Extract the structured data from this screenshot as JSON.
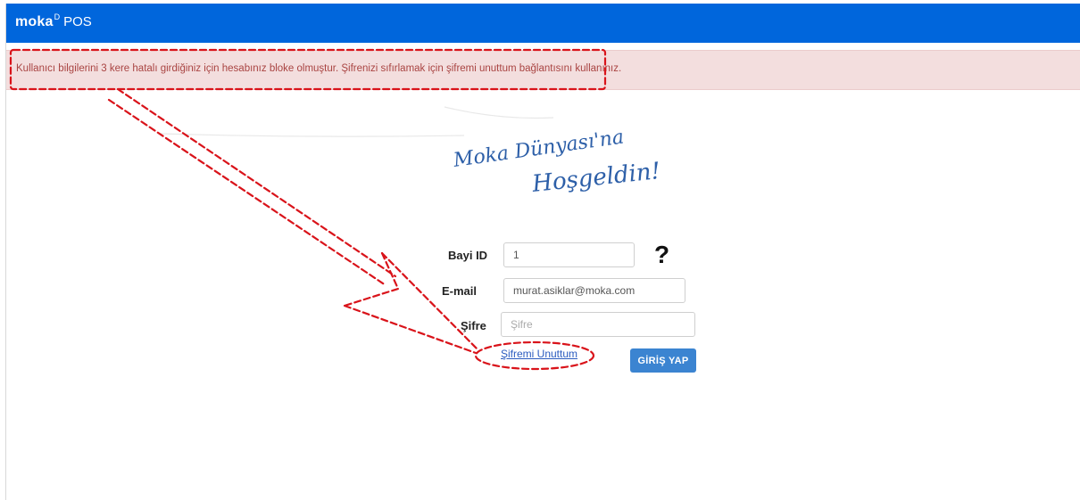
{
  "header": {
    "brand_logo": "moka",
    "brand_sup": "D",
    "app_name": "POS"
  },
  "alert": {
    "message": "Kullanıcı bilgilerini 3 kere hatalı girdiğiniz için hesabınız bloke olmuştur. Şifrenizi sıfırlamak için şifremi unuttum bağlantısını kullanınız."
  },
  "welcome": {
    "line1": "Moka Dünyası'na",
    "line2": "Hoşgeldin!"
  },
  "form": {
    "bayi_id": {
      "label": "Bayi ID",
      "value": "1"
    },
    "help_symbol": "?",
    "email": {
      "label": "E-mail",
      "value": "murat.asiklar@moka.com"
    },
    "password": {
      "label": "Şifre",
      "placeholder": "Şifre"
    },
    "forgot_link": "Şifremi Unuttum",
    "login_button": "GİRİŞ YAP"
  },
  "colors": {
    "topbar": "#0066dc",
    "alert_bg": "#f3dede",
    "alert_text": "#a94442",
    "annotation": "#d9131a",
    "button": "#3b84d1"
  }
}
